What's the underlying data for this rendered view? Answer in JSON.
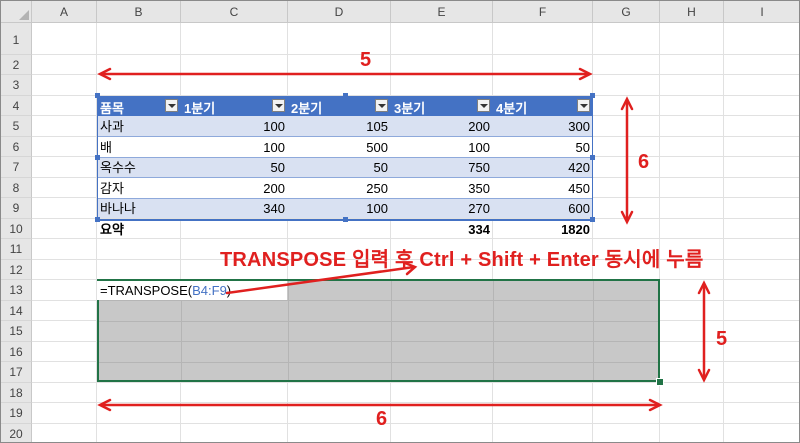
{
  "columns": [
    "A",
    "B",
    "C",
    "D",
    "E",
    "F",
    "G",
    "H",
    "I"
  ],
  "rows": [
    "1",
    "2",
    "3",
    "4",
    "5",
    "6",
    "7",
    "8",
    "9",
    "10",
    "11",
    "12",
    "13",
    "14",
    "15",
    "16",
    "17",
    "18",
    "19",
    "20"
  ],
  "table": {
    "headers": [
      "품목",
      "1분기",
      "2분기",
      "3분기",
      "4분기"
    ],
    "data": [
      {
        "item": "사과",
        "q1": "100",
        "q2": "105",
        "q3": "200",
        "q4": "300"
      },
      {
        "item": "배",
        "q1": "100",
        "q2": "500",
        "q3": "100",
        "q4": "50"
      },
      {
        "item": "옥수수",
        "q1": "50",
        "q2": "50",
        "q3": "750",
        "q4": "420"
      },
      {
        "item": "감자",
        "q1": "200",
        "q2": "250",
        "q3": "350",
        "q4": "450"
      },
      {
        "item": "바나나",
        "q1": "340",
        "q2": "100",
        "q3": "270",
        "q4": "600"
      }
    ],
    "total": {
      "label": "요약",
      "q3": "334",
      "q4": "1820"
    }
  },
  "formula": {
    "prefix": "=TRANSPOSE(",
    "ref": "B4:F9",
    "suffix": ")"
  },
  "annotations": {
    "width_top": "5",
    "height_right": "6",
    "instruction": "TRANSPOSE 입력 후 Ctrl + Shift + Enter 동시에 누름",
    "height_lower": "5",
    "width_bottom": "6"
  },
  "colors": {
    "table_header": "#4472c4",
    "band": "#d9e1f2",
    "selection_fill": "#c8c8c8",
    "selection_border": "#217346",
    "annotation": "#e0201f"
  }
}
